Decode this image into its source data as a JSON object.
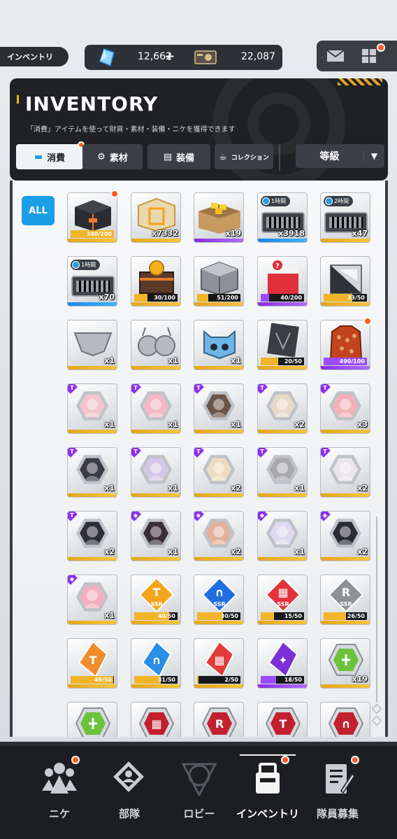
{
  "screen_tag": "インベントリ",
  "currency": {
    "gems": "12,662",
    "plus": "+",
    "credits": "22,087"
  },
  "panel": {
    "title": "INVENTORY",
    "subtitle": "「消費」アイテムを使って財貨・素材・装備・ニケを獲得できます",
    "tabs": [
      {
        "label": "消費",
        "icon": "consumable-icon",
        "active": true
      },
      {
        "label": "素材",
        "icon": "material-icon",
        "active": false
      },
      {
        "label": "装備",
        "icon": "equipment-icon",
        "active": false
      },
      {
        "label": "コレクション",
        "icon": "collection-icon",
        "active": false
      }
    ],
    "sort_label": "等級"
  },
  "filter_all": "ALL",
  "items": [
    [
      {
        "kind": "dark-box",
        "rarity": "sr",
        "bar": "340/200",
        "fill": 1.0,
        "dot": true
      },
      {
        "kind": "gold-box",
        "rarity": "sr",
        "count": "x7332"
      },
      {
        "kind": "cardboard-box",
        "rarity": "ssr",
        "count": "x19"
      },
      {
        "kind": "time-case",
        "rarity": "r",
        "count": "x3918",
        "timer": "1時間"
      },
      {
        "kind": "time-case",
        "rarity": "sr",
        "count": "x47",
        "timer": "2時間"
      }
    ],
    [
      {
        "kind": "time-case",
        "rarity": "r",
        "count": "x70",
        "timer": "1時間"
      },
      {
        "kind": "coin-chest",
        "rarity": "sr",
        "bar": "30/100",
        "fill": 0.3
      },
      {
        "kind": "metal-box",
        "rarity": "sr",
        "bar": "51/200",
        "fill": 0.255
      },
      {
        "kind": "red-box",
        "rarity": "ssr",
        "bar": "40/200",
        "fill": 0.2
      },
      {
        "kind": "photo-box",
        "rarity": "sr",
        "bar": "33/50",
        "fill": 0.66
      }
    ],
    [
      {
        "kind": "silver-garment",
        "rarity": "sr",
        "count": "x1"
      },
      {
        "kind": "silver-top",
        "rarity": "sr",
        "count": "x1"
      },
      {
        "kind": "robot-head",
        "rarity": "sr",
        "count": "x1"
      },
      {
        "kind": "dark-card",
        "rarity": "sr",
        "bar": "20/50",
        "fill": 0.4
      },
      {
        "kind": "red-jacket",
        "rarity": "ssr",
        "bar": "490/100",
        "fill": 1.0,
        "dot": true
      }
    ],
    [
      {
        "kind": "portrait",
        "rarity": "sr",
        "count": "x1",
        "face": "#f2c4cc",
        "rib": "T"
      },
      {
        "kind": "portrait",
        "rarity": "sr",
        "count": "x1",
        "face": "#f3b7c6",
        "rib": "T"
      },
      {
        "kind": "portrait",
        "rarity": "sr",
        "count": "x1",
        "face": "#6a5548",
        "rib": "T"
      },
      {
        "kind": "portrait",
        "rarity": "sr",
        "count": "x2",
        "face": "#e7d8c8",
        "rib": "T"
      },
      {
        "kind": "portrait",
        "rarity": "sr",
        "count": "x3",
        "face": "#f4b1b8",
        "rib": "T"
      }
    ],
    [
      {
        "kind": "portrait",
        "rarity": "sr",
        "count": "x1",
        "face": "#3b3b45",
        "rib": "T"
      },
      {
        "kind": "portrait",
        "rarity": "sr",
        "count": "x1",
        "face": "#d3c6e6",
        "rib": "T"
      },
      {
        "kind": "portrait",
        "rarity": "sr",
        "count": "x2",
        "face": "#efdcc0",
        "rib": "T"
      },
      {
        "kind": "portrait",
        "rarity": "sr",
        "count": "x1",
        "face": "#a9a9ad",
        "rib": "T"
      },
      {
        "kind": "portrait",
        "rarity": "sr",
        "count": "x2",
        "face": "#eae6ea",
        "rib": "T"
      }
    ],
    [
      {
        "kind": "portrait",
        "rarity": "sr",
        "count": "x2",
        "face": "#2e2f37",
        "rib": "T"
      },
      {
        "kind": "portrait",
        "rarity": "sr",
        "count": "x1",
        "face": "#3a2f35",
        "rib": "◆"
      },
      {
        "kind": "portrait",
        "rarity": "sr",
        "count": "x2",
        "face": "#e4b09a",
        "rib": "◆"
      },
      {
        "kind": "portrait",
        "rarity": "sr",
        "count": "x1",
        "face": "#dfd9f0",
        "rib": "◆"
      },
      {
        "kind": "portrait",
        "rarity": "sr",
        "count": "x2",
        "face": "#2a2b33",
        "rib": "◆"
      }
    ],
    [
      {
        "kind": "portrait",
        "rarity": "sr",
        "count": "x1",
        "face": "#f3aec0",
        "rib": "◆"
      },
      {
        "kind": "ssr-shard",
        "rarity": "sr",
        "bar": "40/50",
        "fill": 0.8,
        "shard": "#f4a51c",
        "glyph": "T"
      },
      {
        "kind": "ssr-shard",
        "rarity": "sr",
        "bar": "30/50",
        "fill": 0.6,
        "shard": "#1f6fe0",
        "glyph": "∩"
      },
      {
        "kind": "ssr-shard",
        "rarity": "sr",
        "bar": "15/50",
        "fill": 0.3,
        "shard": "#e5323a",
        "glyph": "▦"
      },
      {
        "kind": "ssr-shard",
        "rarity": "sr",
        "bar": "26/50",
        "fill": 0.52,
        "shard": "#8e9196",
        "glyph": "R"
      }
    ],
    [
      {
        "kind": "shard",
        "rarity": "sr",
        "bar": "49/50",
        "fill": 0.98,
        "shard": "#f08c2a",
        "glyph": "T"
      },
      {
        "kind": "shard",
        "rarity": "sr",
        "bar": "31/50",
        "fill": 0.62,
        "shard": "#2a8de8",
        "glyph": "∩"
      },
      {
        "kind": "shard",
        "rarity": "sr",
        "bar": "2/50",
        "fill": 0.04,
        "shard": "#e13b3b",
        "glyph": "▦"
      },
      {
        "kind": "shard",
        "rarity": "ssr",
        "bar": "18/50",
        "fill": 0.36,
        "shard": "#7d2fd8",
        "glyph": "✦"
      },
      {
        "kind": "green-hex",
        "rarity": "sr",
        "count": "x19"
      }
    ],
    [
      {
        "kind": "green-hex",
        "rarity": "sr",
        "count": ""
      },
      {
        "kind": "red-hex",
        "rarity": "sr",
        "count": "",
        "glyph": "▦"
      },
      {
        "kind": "red-hex",
        "rarity": "sr",
        "count": "",
        "glyph": "R"
      },
      {
        "kind": "red-hex",
        "rarity": "sr",
        "count": "",
        "glyph": "T"
      },
      {
        "kind": "red-hex",
        "rarity": "sr",
        "count": "",
        "glyph": "∩"
      }
    ]
  ],
  "nav": [
    {
      "label": "ニケ",
      "icon": "nikke-icon",
      "dot": true,
      "active": false
    },
    {
      "label": "部隊",
      "icon": "squad-icon",
      "dot": false,
      "active": false
    },
    {
      "label": "ロビー",
      "icon": "lobby-icon",
      "dot": false,
      "active": false
    },
    {
      "label": "インベントリ",
      "icon": "inventory-icon",
      "dot": true,
      "active": true
    },
    {
      "label": "隊員募集",
      "icon": "recruit-icon",
      "dot": true,
      "active": false
    }
  ],
  "colors": {
    "accent": "#1a9ee6",
    "sr": "#f2b52a",
    "r": "#2a9bf0",
    "ssr": "#9a4dff",
    "badge": "#ff5a1f"
  }
}
